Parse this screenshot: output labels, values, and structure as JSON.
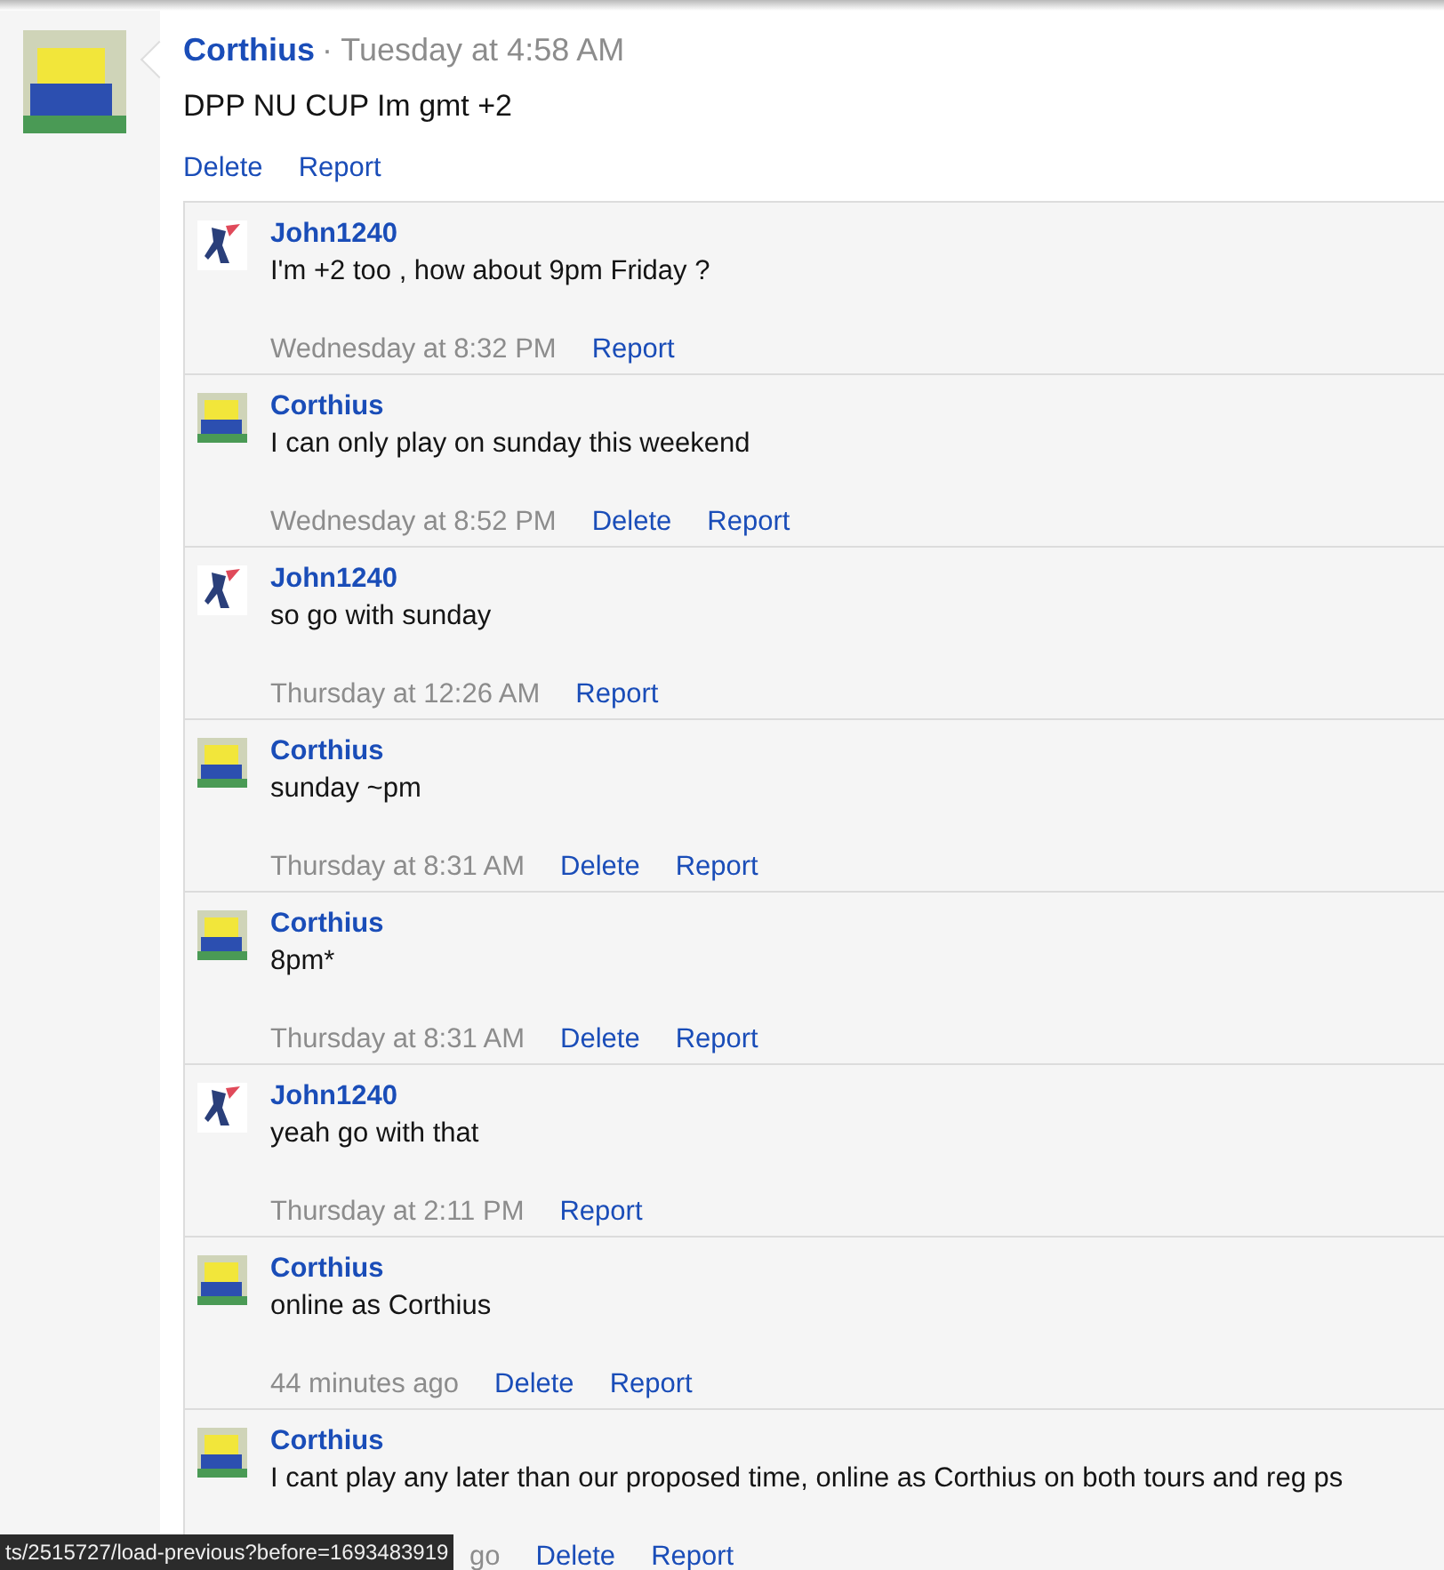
{
  "post": {
    "author": "Corthius",
    "time": "· Tuesday at 4:58 AM",
    "message": "DPP NU CUP Im gmt +2",
    "actions": [
      "Delete",
      "Report"
    ]
  },
  "replies": [
    {
      "author": "John1240",
      "kind": "ninja",
      "message": "I'm +2 too , how about 9pm Friday ?",
      "time": "Wednesday at 8:32 PM",
      "actions": [
        "Report"
      ]
    },
    {
      "author": "Corthius",
      "kind": "sponge",
      "message": "I can only play on sunday this weekend",
      "time": "Wednesday at 8:52 PM",
      "actions": [
        "Delete",
        "Report"
      ]
    },
    {
      "author": "John1240",
      "kind": "ninja",
      "message": "so go with sunday",
      "time": "Thursday at 12:26 AM",
      "actions": [
        "Report"
      ]
    },
    {
      "author": "Corthius",
      "kind": "sponge",
      "message": "sunday ~pm",
      "time": "Thursday at 8:31 AM",
      "actions": [
        "Delete",
        "Report"
      ]
    },
    {
      "author": "Corthius",
      "kind": "sponge",
      "message": "8pm*",
      "time": "Thursday at 8:31 AM",
      "actions": [
        "Delete",
        "Report"
      ]
    },
    {
      "author": "John1240",
      "kind": "ninja",
      "message": "yeah go with that",
      "time": "Thursday at 2:11 PM",
      "actions": [
        "Report"
      ]
    },
    {
      "author": "Corthius",
      "kind": "sponge",
      "message": "online as Corthius",
      "time": "44 minutes ago",
      "actions": [
        "Delete",
        "Report"
      ]
    },
    {
      "author": "Corthius",
      "kind": "sponge",
      "message": "I cant play any later than our proposed time, online as Corthius on both tours and reg ps",
      "time": "go",
      "covered": true,
      "actions": [
        "Delete",
        "Report"
      ]
    }
  ],
  "status_tooltip": "ts/2515727/load-previous?before=1693483919"
}
